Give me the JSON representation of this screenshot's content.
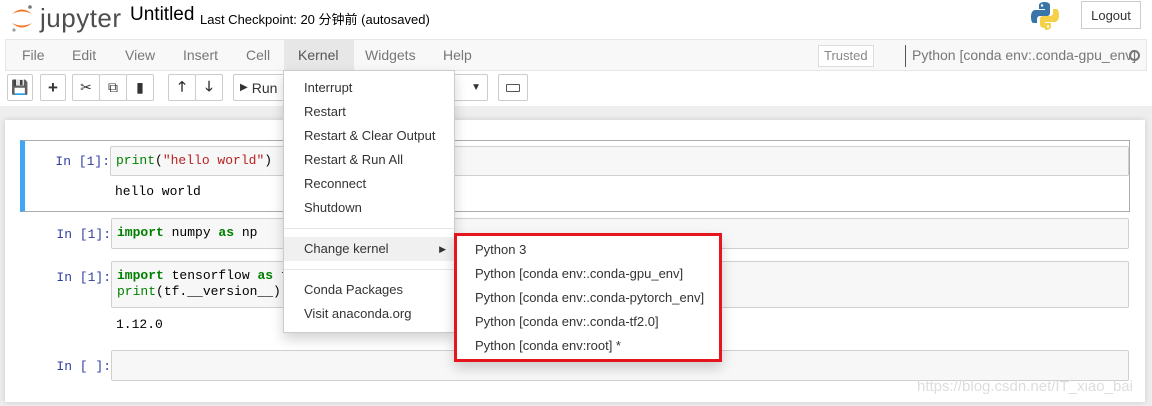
{
  "header": {
    "logo_text": "jupyter",
    "title": "Untitled",
    "checkpoint": "Last Checkpoint: 20 分钟前   (autosaved)",
    "logout": "Logout"
  },
  "menubar": {
    "items": [
      "File",
      "Edit",
      "View",
      "Insert",
      "Cell",
      "Kernel",
      "Widgets",
      "Help"
    ],
    "trusted": "Trusted",
    "kernel_name": "Python [conda env:.conda-gpu_env]"
  },
  "toolbar": {
    "run_label": "Run"
  },
  "cells": [
    {
      "prompt": "In  [1]:",
      "output": "hello world"
    },
    {
      "prompt": "In  [1]:"
    },
    {
      "prompt": "In  [1]:",
      "output": "1.12.0"
    },
    {
      "prompt": "In  [ ]:"
    }
  ],
  "code": {
    "print": "print",
    "hello_str": "\"hello world\"",
    "import": "import",
    "numpy": " numpy ",
    "as": "as",
    "np": " np",
    "tensorflow": " tensorflow ",
    "tf": " tf",
    "version_line": "(tf.__version__)"
  },
  "kernel_menu": {
    "items": [
      "Interrupt",
      "Restart",
      "Restart & Clear Output",
      "Restart & Run All",
      "Reconnect",
      "Shutdown"
    ],
    "change_kernel": "Change kernel",
    "extra": [
      "Conda Packages",
      "Visit anaconda.org"
    ]
  },
  "change_kernel_submenu": [
    "Python 3",
    "Python [conda env:.conda-gpu_env]",
    "Python [conda env:.conda-pytorch_env]",
    "Python [conda env:.conda-tf2.0]",
    "Python [conda env:root] *"
  ],
  "watermark": "https://blog.csdn.net/IT_xiao_bai"
}
